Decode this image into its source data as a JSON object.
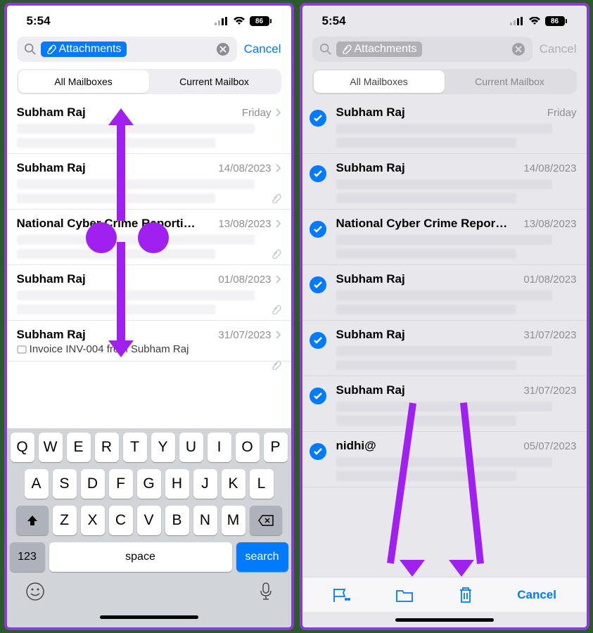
{
  "status": {
    "time": "5:54",
    "battery": "86"
  },
  "search": {
    "chip_label": "Attachments",
    "cancel": "Cancel"
  },
  "segmented": {
    "all": "All Mailboxes",
    "current": "Current Mailbox"
  },
  "left_rows": [
    {
      "sender": "Subham Raj",
      "date": "Friday"
    },
    {
      "sender": "Subham Raj",
      "date": "14/08/2023"
    },
    {
      "sender": "National Cyber Crime Reportin…",
      "date": "13/08/2023"
    },
    {
      "sender": "Subham Raj",
      "date": "01/08/2023"
    },
    {
      "sender": "Subham Raj",
      "date": "31/07/2023",
      "subject": "Invoice INV-004 from Subham Raj"
    }
  ],
  "right_rows": [
    {
      "sender": "Subham Raj",
      "date": "Friday"
    },
    {
      "sender": "Subham Raj",
      "date": "14/08/2023"
    },
    {
      "sender": "National Cyber Crime Repor…",
      "date": "13/08/2023"
    },
    {
      "sender": "Subham Raj",
      "date": "01/08/2023"
    },
    {
      "sender": "Subham Raj",
      "date": "31/07/2023"
    },
    {
      "sender": "Subham Raj",
      "date": "31/07/2023"
    },
    {
      "sender": "nidhi@",
      "date": "05/07/2023"
    }
  ],
  "keyboard": {
    "row1": [
      "Q",
      "W",
      "E",
      "R",
      "T",
      "Y",
      "U",
      "I",
      "O",
      "P"
    ],
    "row2": [
      "A",
      "S",
      "D",
      "F",
      "G",
      "H",
      "J",
      "K",
      "L"
    ],
    "row3": [
      "Z",
      "X",
      "C",
      "V",
      "B",
      "N",
      "M"
    ],
    "num": "123",
    "space": "space",
    "search": "search"
  },
  "toolbar": {
    "cancel": "Cancel"
  }
}
